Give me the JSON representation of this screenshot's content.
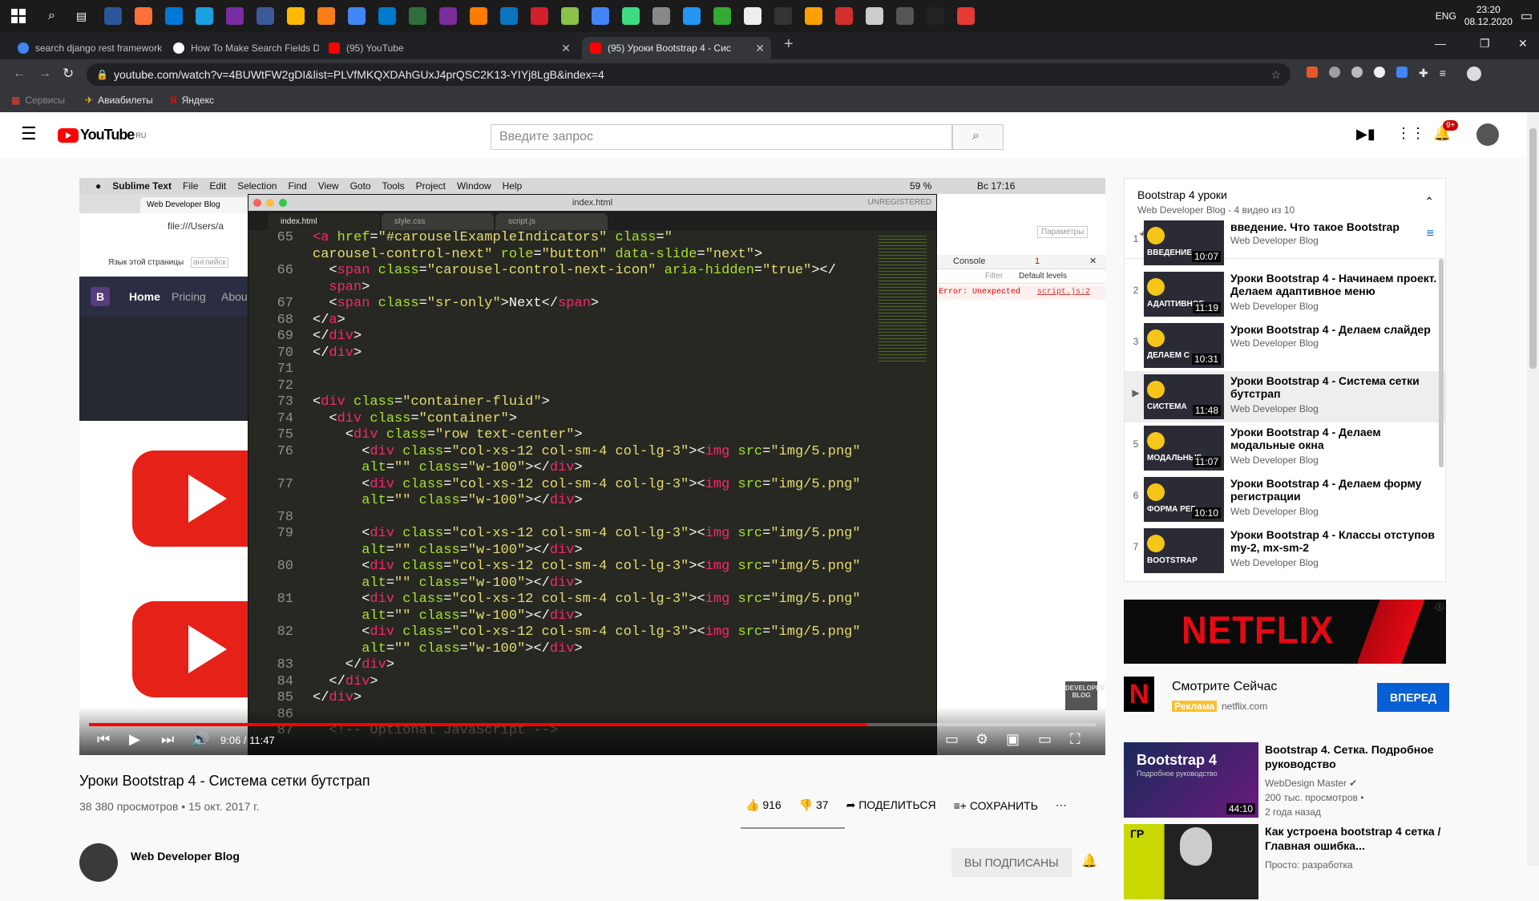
{
  "taskbar": {
    "clock_time": "23:20",
    "clock_date": "08.12.2020",
    "lang": "ENG"
  },
  "tabs": [
    {
      "title": "search django rest framework - Google"
    },
    {
      "title": "How To Make Search Fields Dyna"
    },
    {
      "title": "(95) YouTube"
    },
    {
      "title": "(95) Уроки Bootstrap 4 - Сис"
    }
  ],
  "address": {
    "url": "youtube.com/watch?v=4BUWtFW2gDI&list=PLVfMKQXDAhGUxJ4prQSC2K13-YIYj8LgB&index=4"
  },
  "bookmarks": [
    {
      "label": "Сервисы"
    },
    {
      "label": "Авиабилеты"
    },
    {
      "label": "Яндекс"
    }
  ],
  "youtube": {
    "logo_text": "YouTube",
    "logo_region": "RU",
    "search_placeholder": "Введите запрос",
    "notif_count": "9+"
  },
  "player": {
    "mac_menu": [
      "Sublime Text",
      "File",
      "Edit",
      "Selection",
      "Find",
      "View",
      "Goto",
      "Tools",
      "Project",
      "Window",
      "Help"
    ],
    "mac_status": "59 %",
    "mac_clock": "Вс 17:16",
    "browser_tab": "Web Developer Blog",
    "browser_url": "file:///Users/a",
    "translate_text": "Язык этой страницы",
    "translate_lang": "английск",
    "bs_nav": [
      "B",
      "Home",
      "Pricing",
      "Abou"
    ],
    "sublime_title": "index.html",
    "sublime_unreg": "UNREGISTERED",
    "sublime_tabs": [
      "index.html",
      "style.css",
      "script.js"
    ],
    "devtools_tab": "Console",
    "devtools_filter": "Filter",
    "devtools_levels": "Default levels",
    "devtools_params": "Параметры",
    "devtools_error": "Error: Unexpected",
    "devtools_src": "script.js:2",
    "devtools_err_count": "1",
    "code_lines": [
      {
        "n": "65",
        "html": "<span class=\"t\">&lt;a</span> <span class=\"a\">href</span>=<span class=\"s\">\"#carouselExampleIndicators\"</span> <span class=\"a\">class</span>=<span class=\"s\">\"</span>"
      },
      {
        "n": "",
        "html": "<span class=\"s\">carousel-control-next\"</span> <span class=\"a\">role</span>=<span class=\"s\">\"button\"</span> <span class=\"a\">data-slide</span>=<span class=\"s\">\"next\"</span>&gt;"
      },
      {
        "n": "66",
        "html": "  &lt;<span class=\"t\">span</span> <span class=\"a\">class</span>=<span class=\"s\">\"carousel-control-next-icon\"</span> <span class=\"a\">aria-hidden</span>=<span class=\"s\">\"true\"</span>&gt;&lt;/"
      },
      {
        "n": "",
        "html": "  <span class=\"t\">span</span>&gt;"
      },
      {
        "n": "67",
        "html": "  &lt;<span class=\"t\">span</span> <span class=\"a\">class</span>=<span class=\"s\">\"sr-only\"</span>&gt;Next&lt;/<span class=\"t\">span</span>&gt;"
      },
      {
        "n": "68",
        "html": "&lt;/<span class=\"t\">a</span>&gt;"
      },
      {
        "n": "69",
        "html": "&lt;/<span class=\"t\">div</span>&gt;"
      },
      {
        "n": "70",
        "html": "&lt;/<span class=\"t\">div</span>&gt;"
      },
      {
        "n": "71",
        "html": ""
      },
      {
        "n": "72",
        "html": ""
      },
      {
        "n": "73",
        "html": "&lt;<span class=\"t\">div</span> <span class=\"a\">class</span>=<span class=\"s\">\"container-fluid\"</span>&gt;"
      },
      {
        "n": "74",
        "html": "  &lt;<span class=\"t\">div</span> <span class=\"a\">class</span>=<span class=\"s\">\"container\"</span>&gt;"
      },
      {
        "n": "75",
        "html": "    &lt;<span class=\"t\">div</span> <span class=\"a\">class</span>=<span class=\"s\">\"row text-center\"</span>&gt;"
      },
      {
        "n": "76",
        "html": "      &lt;<span class=\"t\">div</span> <span class=\"a\">class</span>=<span class=\"s\">\"col-xs-12 col-sm-4 col-lg-3\"</span>&gt;&lt;<span class=\"t\">img</span> <span class=\"a\">src</span>=<span class=\"s\">\"img/5.png\"</span>"
      },
      {
        "n": "",
        "html": "      <span class=\"a\">alt</span>=<span class=\"s\">\"\"</span> <span class=\"a\">class</span>=<span class=\"s\">\"w-100\"</span>&gt;&lt;/<span class=\"t\">div</span>&gt;"
      },
      {
        "n": "77",
        "html": "      &lt;<span class=\"t\">div</span> <span class=\"a\">class</span>=<span class=\"s\">\"col-xs-12 col-sm-4 col-lg-3\"</span>&gt;&lt;<span class=\"t\">img</span> <span class=\"a\">src</span>=<span class=\"s\">\"img/5.png\"</span>"
      },
      {
        "n": "",
        "html": "      <span class=\"a\">alt</span>=<span class=\"s\">\"\"</span> <span class=\"a\">class</span>=<span class=\"s\">\"w-100\"</span>&gt;&lt;/<span class=\"t\">div</span>&gt;"
      },
      {
        "n": "78",
        "html": ""
      },
      {
        "n": "79",
        "html": "      &lt;<span class=\"t\">div</span> <span class=\"a\">class</span>=<span class=\"s\">\"col-xs-12 col-sm-4 col-lg-3\"</span>&gt;&lt;<span class=\"t\">img</span> <span class=\"a\">src</span>=<span class=\"s\">\"img/5.png\"</span>"
      },
      {
        "n": "",
        "html": "      <span class=\"a\">alt</span>=<span class=\"s\">\"\"</span> <span class=\"a\">class</span>=<span class=\"s\">\"w-100\"</span>&gt;&lt;/<span class=\"t\">div</span>&gt;"
      },
      {
        "n": "80",
        "html": "      &lt;<span class=\"t\">div</span> <span class=\"a\">class</span>=<span class=\"s\">\"col-xs-12 col-sm-4 col-lg-3\"</span>&gt;&lt;<span class=\"t\">img</span> <span class=\"a\">src</span>=<span class=\"s\">\"img/5.png\"</span>"
      },
      {
        "n": "",
        "html": "      <span class=\"a\">alt</span>=<span class=\"s\">\"\"</span> <span class=\"a\">class</span>=<span class=\"s\">\"w-100\"</span>&gt;&lt;/<span class=\"t\">div</span>&gt;"
      },
      {
        "n": "81",
        "html": "      &lt;<span class=\"t\">div</span> <span class=\"a\">class</span>=<span class=\"s\">\"col-xs-12 col-sm-4 col-lg-3\"</span>&gt;&lt;<span class=\"t\">img</span> <span class=\"a\">src</span>=<span class=\"s\">\"img/5.png\"</span>"
      },
      {
        "n": "",
        "html": "      <span class=\"a\">alt</span>=<span class=\"s\">\"\"</span> <span class=\"a\">class</span>=<span class=\"s\">\"w-100\"</span>&gt;&lt;/<span class=\"t\">div</span>&gt;"
      },
      {
        "n": "82",
        "html": "      &lt;<span class=\"t\">div</span> <span class=\"a\">class</span>=<span class=\"s\">\"col-xs-12 col-sm-4 col-lg-3\"</span>&gt;&lt;<span class=\"t\">img</span> <span class=\"a\">src</span>=<span class=\"s\">\"img/5.png\"</span>"
      },
      {
        "n": "",
        "html": "      <span class=\"a\">alt</span>=<span class=\"s\">\"\"</span> <span class=\"a\">class</span>=<span class=\"s\">\"w-100\"</span>&gt;&lt;/<span class=\"t\">div</span>&gt;"
      },
      {
        "n": "83",
        "html": "    &lt;/<span class=\"t\">div</span>&gt;"
      },
      {
        "n": "84",
        "html": "  &lt;/<span class=\"t\">div</span>&gt;"
      },
      {
        "n": "85",
        "html": "&lt;/<span class=\"t\">div</span>&gt;"
      },
      {
        "n": "86",
        "html": ""
      },
      {
        "n": "87",
        "html": "  <span class=\"c\">&lt;!-- Optional JavaScript --&gt;</span>"
      }
    ],
    "watermark": "DEVELOPER BLOG",
    "time": "9:06 / 11:47",
    "progress": 0.773
  },
  "video": {
    "title": "Уроки Bootstrap 4 - Система сетки бутстрап",
    "meta": "38 380 просмотров • 15 окт. 2017 г.",
    "likes": "916",
    "dislikes": "37",
    "share": "ПОДЕЛИТЬСЯ",
    "save": "СОХРАНИТЬ",
    "channel": "Web Developer Blog",
    "subscribed": "ВЫ ПОДПИСАНЫ"
  },
  "playlist": {
    "title": "Bootstrap 4 уроки",
    "subtitle": "Web Developer Blog - 4 видео из 10",
    "items": [
      {
        "idx": "1",
        "title": "введение. Что такое Bootstrap",
        "channel": "Web Developer Blog",
        "dur": "10:07",
        "cap": "ВВЕДЕНИЕ"
      },
      {
        "idx": "2",
        "title": "Уроки Bootstrap 4 - Начинаем проект. Делаем адаптивное меню",
        "channel": "Web Developer Blog",
        "dur": "11:19",
        "cap": "АДАПТИВНОЕ"
      },
      {
        "idx": "3",
        "title": "Уроки Bootstrap 4 - Делаем слайдер",
        "channel": "Web Developer Blog",
        "dur": "10:31",
        "cap": "ДЕЛАЕМ С"
      },
      {
        "idx": "▶",
        "title": "Уроки Bootstrap 4 - Система сетки бутстрап",
        "channel": "Web Developer Blog",
        "dur": "11:48",
        "cap": "СИСТЕМА"
      },
      {
        "idx": "5",
        "title": "Уроки Bootstrap 4 - Делаем модальные окна",
        "channel": "Web Developer Blog",
        "dur": "11:07",
        "cap": "МОДАЛЬНЫЕ"
      },
      {
        "idx": "6",
        "title": "Уроки Bootstrap 4 - Делаем форму регистрации",
        "channel": "Web Developer Blog",
        "dur": "10:10",
        "cap": "ФОРМА РЕГ"
      },
      {
        "idx": "7",
        "title": "Уроки Bootstrap 4 - Классы отступов my-2, mx-sm-2",
        "channel": "Web Developer Blog",
        "dur": "",
        "cap": "BOOTSTRAP"
      }
    ]
  },
  "ad": {
    "banner": "NETFLIX",
    "headline": "Смотрите Сейчас",
    "badge": "Реклама",
    "domain": "netflix.com",
    "cta": "ВПЕРЕД"
  },
  "recs": [
    {
      "title": "Bootstrap 4. Сетка. Подробное руководство",
      "channel": "WebDesign Master",
      "views": "200 тыс. просмотров •",
      "age": "2 года назад",
      "dur": "44:10",
      "thumb_title": "Bootstrap 4",
      "thumb_sub": "Подробное руководство"
    },
    {
      "title": "Как устроена bootstrap 4 сетка / Главная ошибка...",
      "channel": "Просто: разработка",
      "views": "",
      "age": "",
      "dur": "",
      "thumb_title": "ГР",
      "thumb_sub": ""
    }
  ]
}
